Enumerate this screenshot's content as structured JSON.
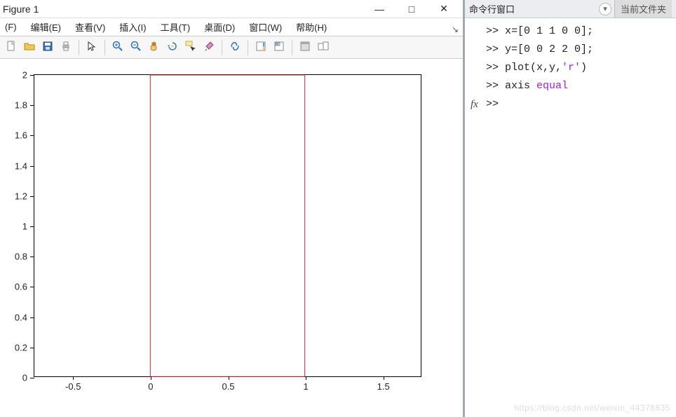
{
  "figure": {
    "title": "Figure 1",
    "window_buttons": {
      "min": "—",
      "max": "□",
      "close": "✕"
    },
    "menubar": [
      {
        "key": "file",
        "label": "(F)"
      },
      {
        "key": "edit",
        "label": "编辑(E)"
      },
      {
        "key": "view",
        "label": "查看(V)"
      },
      {
        "key": "insert",
        "label": "插入(I)"
      },
      {
        "key": "tools",
        "label": "工具(T)"
      },
      {
        "key": "desktop",
        "label": "桌面(D)"
      },
      {
        "key": "window",
        "label": "窗口(W)"
      },
      {
        "key": "help",
        "label": "帮助(H)"
      }
    ],
    "toolbar": [
      "new",
      "open",
      "save",
      "print",
      "|",
      "pointer",
      "|",
      "zoom-in",
      "zoom-out",
      "pan",
      "rotate",
      "data-cursor",
      "brush",
      "|",
      "link",
      "|",
      "colorbar",
      "legend",
      "|",
      "hide-tools",
      "dock"
    ],
    "x_ticks": [
      -0.5,
      0,
      0.5,
      1,
      1.5
    ],
    "y_ticks": [
      0,
      0.2,
      0.4,
      0.6,
      0.8,
      1,
      1.2,
      1.4,
      1.6,
      1.8,
      2
    ]
  },
  "cmdwin": {
    "title": "命令行窗口",
    "other_tab": "当前文件夹",
    "lines": [
      {
        "prompt": ">> ",
        "tokens": [
          {
            "t": "x=[0 1 1 0 0];"
          }
        ]
      },
      {
        "prompt": ">> ",
        "tokens": [
          {
            "t": "y=[0 0 2 2 0];"
          }
        ]
      },
      {
        "prompt": ">> ",
        "tokens": [
          {
            "t": "plot(x,y,"
          },
          {
            "t": "'r'",
            "cls": "str"
          },
          {
            "t": ")"
          }
        ]
      },
      {
        "prompt": ">> ",
        "tokens": [
          {
            "t": "axis "
          },
          {
            "t": "equal",
            "cls": "str"
          }
        ]
      },
      {
        "prompt": ">> ",
        "tokens": [],
        "fx": true
      }
    ]
  },
  "watermark": "https://blog.csdn.net/weixin_44378835",
  "chart_data": {
    "type": "line",
    "x": [
      0,
      1,
      1,
      0,
      0
    ],
    "y": [
      0,
      0,
      2,
      2,
      0
    ],
    "xlim": [
      -0.75,
      1.75
    ],
    "ylim": [
      0,
      2
    ],
    "line_color": "#cc2222",
    "title": "",
    "xlabel": "",
    "ylabel": ""
  }
}
